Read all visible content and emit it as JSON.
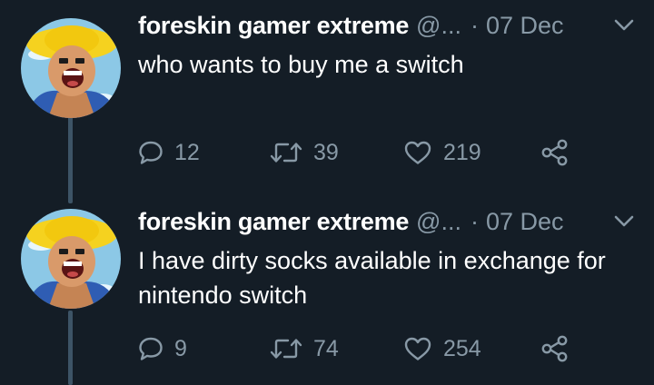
{
  "colors": {
    "background": "#141d26",
    "text_primary": "#ffffff",
    "text_secondary": "#8899a6",
    "thread_line": "#3d5466"
  },
  "tweets": [
    {
      "display_name": "foreskin gamer extreme",
      "handle": "@...",
      "separator": "·",
      "date": "07 Dec",
      "text": "who wants to buy me a switch",
      "replies": "12",
      "retweets": "39",
      "likes": "219",
      "icons": [
        "reply-icon",
        "retweet-icon",
        "like-icon",
        "share-icon",
        "chevron-down-icon"
      ]
    },
    {
      "display_name": "foreskin gamer extreme",
      "handle": "@...",
      "separator": "·",
      "date": "07 Dec",
      "text": "I have dirty socks available in exchange for nintendo switch",
      "replies": "9",
      "retweets": "74",
      "likes": "254",
      "icons": [
        "reply-icon",
        "retweet-icon",
        "like-icon",
        "share-icon",
        "chevron-down-icon"
      ]
    }
  ]
}
